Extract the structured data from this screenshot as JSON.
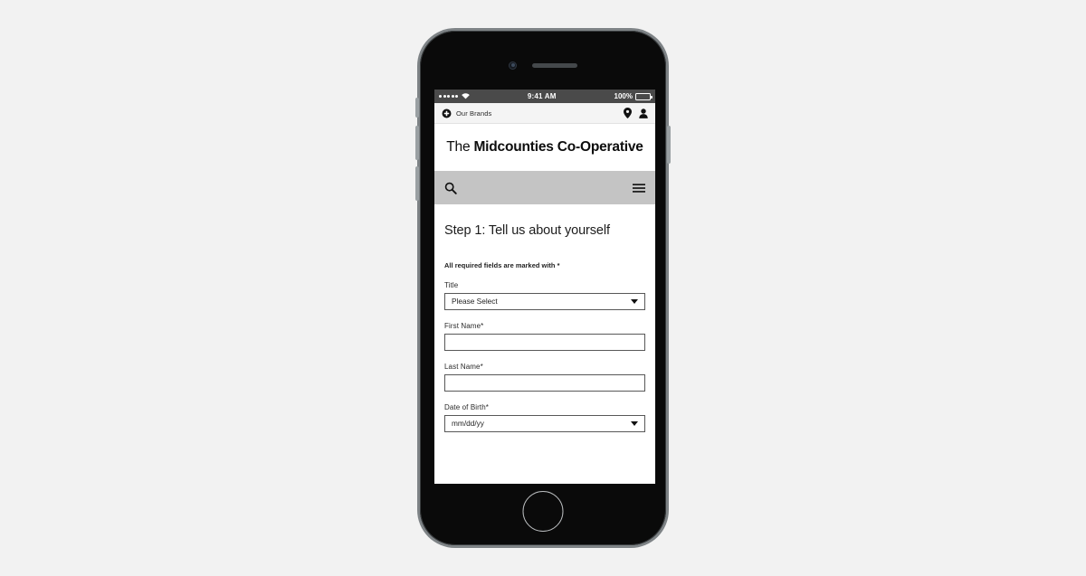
{
  "device": {
    "name": "smartphone-mockup",
    "home_button": "home-button",
    "camera": "front-camera",
    "speaker": "earpiece-speaker"
  },
  "status_bar": {
    "signal_dots": 5,
    "wifi": "wifi-icon",
    "time": "9:41 AM",
    "battery_percent": "100%",
    "battery_level": 100
  },
  "utility_nav": {
    "brands_label": "Our Brands",
    "plus_icon": "plus-circle-icon",
    "location_icon": "location-pin-icon",
    "account_icon": "user-account-icon"
  },
  "brand_header": {
    "logo_prefix": "The ",
    "logo_name": "Midcounties Co-Operative"
  },
  "search_bar": {
    "search_icon": "search-icon",
    "menu_icon": "hamburger-menu-icon",
    "background": "#c4c4c4"
  },
  "main": {
    "title": "Step 1: Tell us about yourself",
    "required_note": "All required fields are marked with *",
    "fields": [
      {
        "label": "Title",
        "type": "select",
        "value": "Please Select",
        "name": "title"
      },
      {
        "label": "First Name*",
        "type": "text",
        "value": "",
        "name": "first-name"
      },
      {
        "label": "Last Name*",
        "type": "text",
        "value": "",
        "name": "last-name"
      },
      {
        "label": "Date of Birth*",
        "type": "select",
        "value": "mm/dd/yy",
        "name": "date-of-birth"
      }
    ]
  },
  "colors": {
    "page_background": "#f2f2f2",
    "status_bar": "#4a4a4a",
    "utility_nav": "#f4f4f4",
    "search_bar": "#c4c4c4",
    "text": "#1c1c1c",
    "field_border": "#585858"
  }
}
